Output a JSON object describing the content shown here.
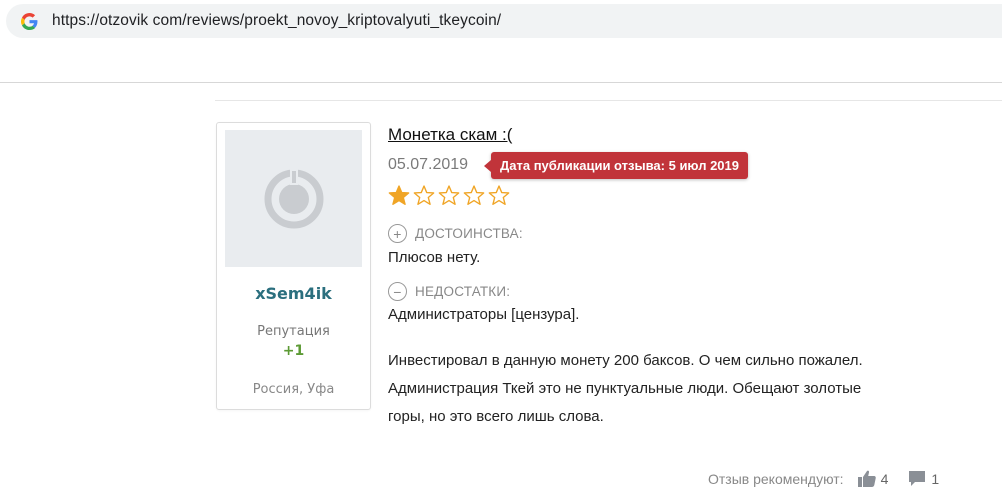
{
  "browser": {
    "url": "https://otzovik com/reviews/proekt_novoy_kriptovalyuti_tkeycoin/",
    "favicon": "google-g-icon"
  },
  "author": {
    "username": "xSem4ik",
    "reputation_label": "Репутация",
    "reputation_value": "+1",
    "location": "Россия, Уфа",
    "avatar": "default-avatar-icon"
  },
  "review": {
    "title": "Монетка скам :(",
    "date": "05.07.2019",
    "tooltip": "Дата публикации отзыва: 5 июл 2019",
    "rating": 1,
    "rating_max": 5,
    "pros_label": "ДОСТОИНСТВА:",
    "pros_text": "Плюсов нету.",
    "cons_label": "НЕДОСТАТКИ:",
    "cons_text": "Администраторы [цензура].",
    "body_lines": [
      "Инвестировал в данную монету 200 баксов. О чем сильно пожалел.",
      "Администрация Ткей это не пунктуальные люди. Обещают золотые",
      "горы, но это всего лишь слова."
    ]
  },
  "footer": {
    "recommend_label": "Отзыв рекомендуют:",
    "likes": "4",
    "comments": "1"
  },
  "colors": {
    "accent_star": "#f0a526",
    "tooltip_bg": "#c1343a",
    "username": "#2b6f7e",
    "reputation": "#5c9a34"
  }
}
